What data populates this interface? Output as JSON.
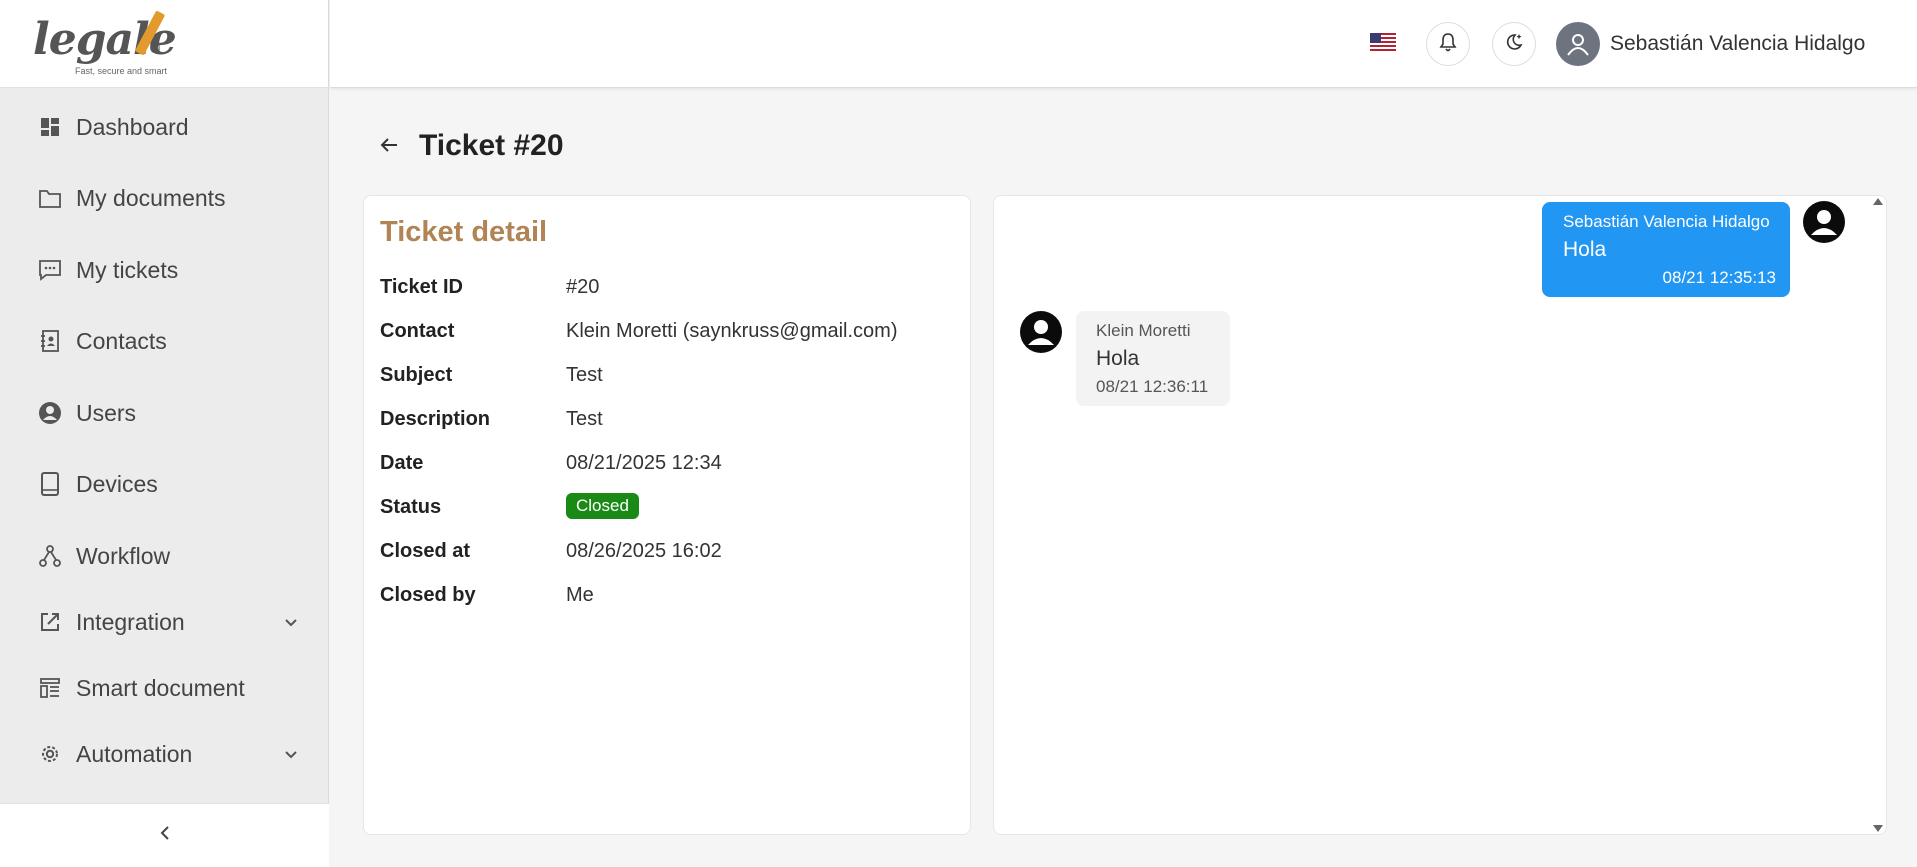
{
  "brand": {
    "logo_word": "legale",
    "logo_reg": "®",
    "tagline": "Fast, secure and smart"
  },
  "sidebar": {
    "items": [
      {
        "label": "Dashboard",
        "icon": "dashboard-icon"
      },
      {
        "label": "My documents",
        "icon": "folder-icon"
      },
      {
        "label": "My tickets",
        "icon": "chat-icon"
      },
      {
        "label": "Contacts",
        "icon": "contacts-book-icon"
      },
      {
        "label": "Users",
        "icon": "user-circle-icon"
      },
      {
        "label": "Devices",
        "icon": "tablet-icon"
      },
      {
        "label": "Workflow",
        "icon": "workflow-icon"
      },
      {
        "label": "Integration",
        "icon": "external-link-icon",
        "expandable": true
      },
      {
        "label": "Smart document",
        "icon": "smart-document-icon"
      },
      {
        "label": "Automation",
        "icon": "gear-icon",
        "expandable": true
      }
    ],
    "collapse_icon": "chevron-left-icon"
  },
  "header": {
    "language_flag": "us-flag-icon",
    "notifications_icon": "bell-icon",
    "theme_icon": "moon-icon",
    "user_name": "Sebastián Valencia Hidalgo"
  },
  "page": {
    "title": "Ticket #20"
  },
  "detail": {
    "title": "Ticket detail",
    "rows": [
      {
        "key": "Ticket ID",
        "value": "#20"
      },
      {
        "key": "Contact",
        "value": "Klein Moretti (saynkruss@gmail.com)"
      },
      {
        "key": "Subject",
        "value": "Test"
      },
      {
        "key": "Description",
        "value": "Test"
      },
      {
        "key": "Date",
        "value": "08/21/2025 12:34"
      },
      {
        "key": "Status",
        "value": "Closed"
      },
      {
        "key": "Closed at",
        "value": "08/26/2025 16:02"
      },
      {
        "key": "Closed by",
        "value": "Me"
      }
    ],
    "status_color": "#1a8a17"
  },
  "chat": {
    "messages": [
      {
        "direction": "outgoing",
        "sender": "Sebastián Valencia Hidalgo",
        "text": "Hola",
        "time": "08/21 12:35:13"
      },
      {
        "direction": "incoming",
        "sender": "Klein Moretti",
        "text": "Hola",
        "time": "08/21 12:36:11"
      }
    ],
    "outgoing_color": "#2196f3",
    "incoming_color": "#f3f3f3"
  },
  "colors": {
    "accent": "#b08454",
    "sidebar_bg": "#ececec"
  }
}
